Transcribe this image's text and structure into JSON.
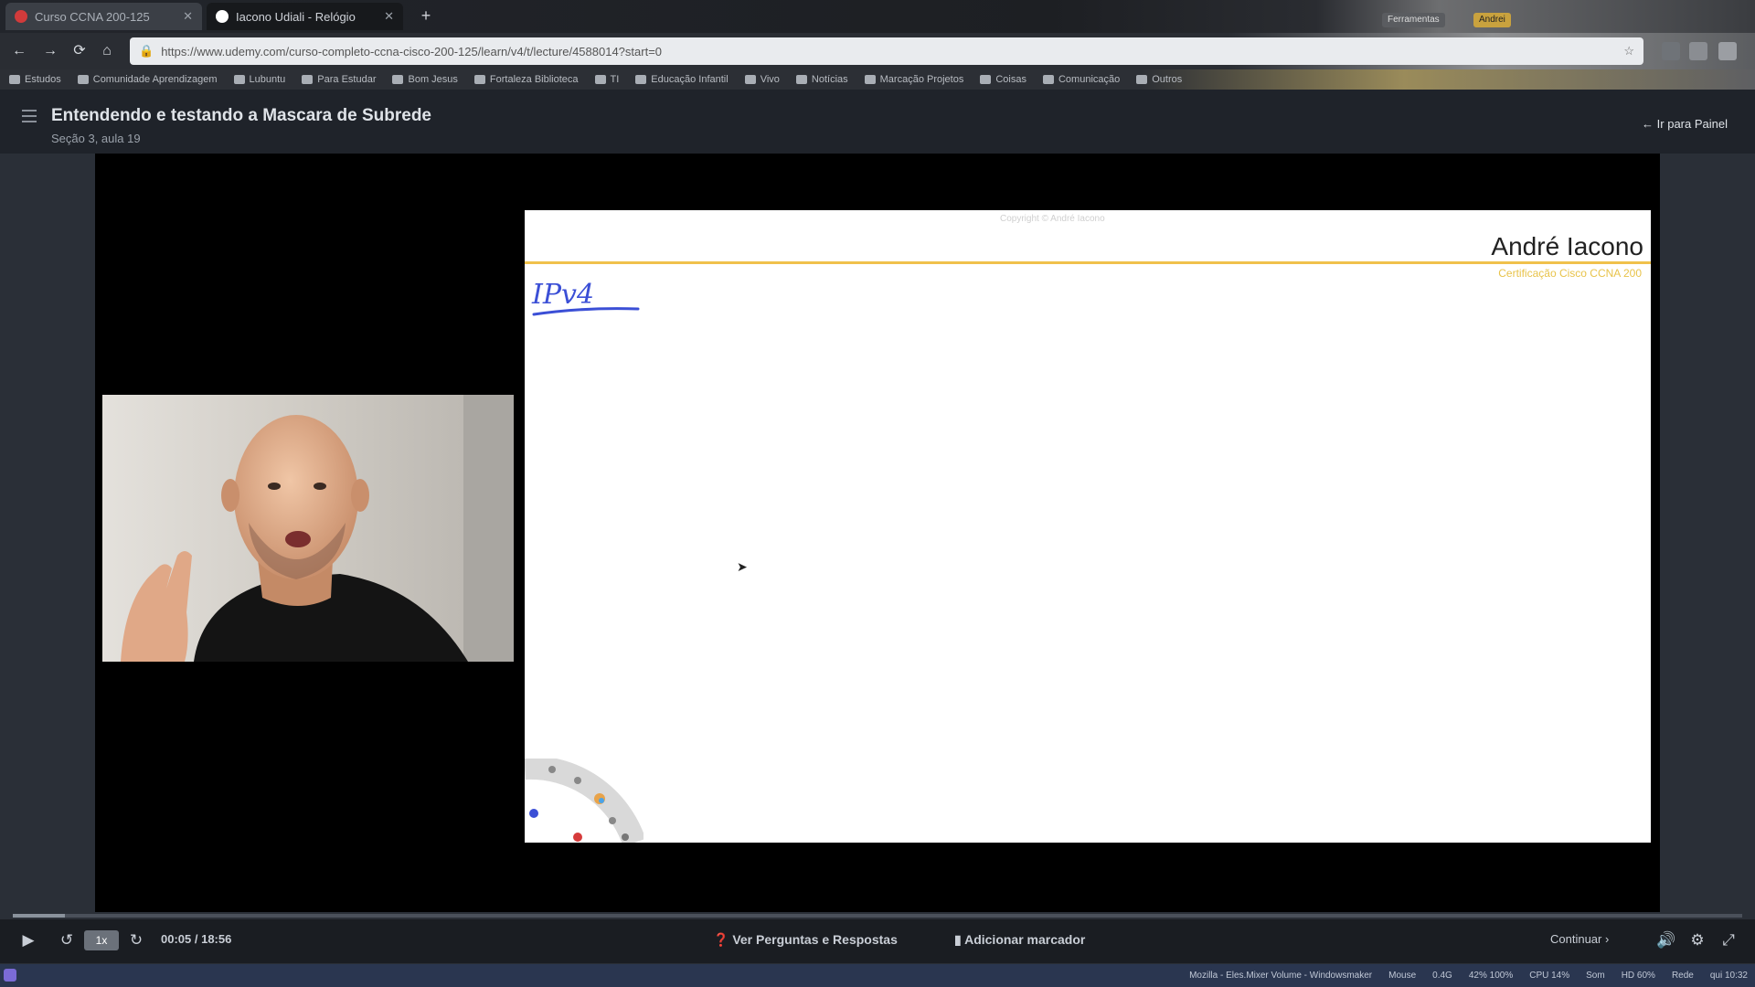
{
  "browser": {
    "tabs": [
      {
        "title": "Curso CCNA 200-125",
        "close": "✕",
        "favicon_color": "#d13b3b"
      },
      {
        "title": "Iacono Udiali - Relógio",
        "close": "✕",
        "favicon_color": "#ffffff"
      }
    ],
    "new_tab": "+",
    "url": "https://www.udemy.com/curso-completo-ccna-cisco-200-125/learn/v4/t/lecture/4588014?start=0",
    "top_buttons": [
      "Ferramentas",
      "Andrei"
    ],
    "bookmarks": [
      "Estudos",
      "Comunidade Aprendizagem",
      "Lubuntu",
      "Para Estudar",
      "Bom Jesus",
      "Fortaleza Biblioteca",
      "TI",
      "Educação Infantil",
      "Vivo",
      "Notícias",
      "Marcação Projetos",
      "Coisas",
      "Comunicação",
      "Outros"
    ],
    "nav": {
      "back": "←",
      "forward": "→",
      "reload": "⟳",
      "home": "⌂",
      "star": "☆"
    }
  },
  "player": {
    "lecture_title": "Entendendo e testando a Mascara de Subrede",
    "lecture_subtitle": "Seção 3, aula 19",
    "back_link": "Ir para Painel",
    "slide": {
      "header_text": "Copyright © André Iacono",
      "author": "André Iacono",
      "certification": "Certificação Cisco CCNA 200",
      "handwriting": "IPv4"
    },
    "controls": {
      "play": "▶",
      "rewind": "↺",
      "speed": "1x",
      "forward": "↻",
      "time": "00:05 / 18:56",
      "questions": "Ver Perguntas e Respostas",
      "bookmark": "Adicionar marcador",
      "continue": "Continuar",
      "volume": "🔊",
      "settings": "⚙",
      "fullscreen": "⤢",
      "progress": 0.03
    }
  },
  "taskbar": {
    "items": [
      "Mozilla - Eles.Mixer Volume - Windowsmaker",
      "Mouse",
      "0.4G",
      "42% 100%",
      "CPU 14%",
      "Som",
      "HD 60%",
      "Rede",
      "qui 10:32"
    ]
  },
  "colors": {
    "accent_yellow": "#f0c14b",
    "slide_bg": "#ffffff",
    "player_bg": "#000000"
  }
}
